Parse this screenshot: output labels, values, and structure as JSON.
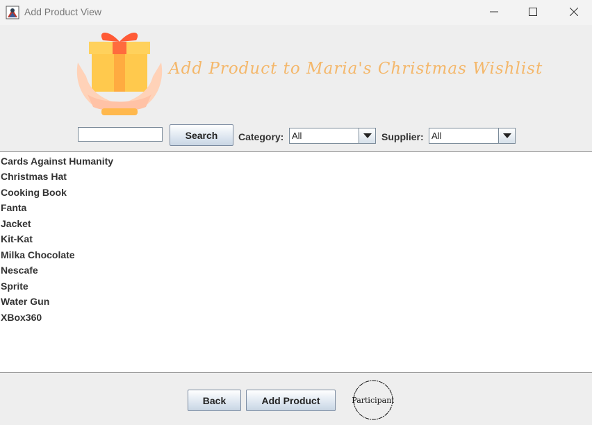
{
  "window": {
    "title": "Add Product View",
    "controls": [
      "minimize-icon",
      "maximize-icon",
      "close-icon"
    ]
  },
  "header": {
    "heading": "Add Product to Maria's Christmas Wishlist",
    "heading_color": "#f4b76a",
    "logo": "gift-in-hands-icon"
  },
  "toolbar": {
    "search_value": "",
    "search_label": "Search",
    "category_label": "Category:",
    "category_value": "All",
    "supplier_label": "Supplier:",
    "supplier_value": "All"
  },
  "products": {
    "items": [
      "Cards Against Humanity",
      "Christmas Hat",
      "Cooking Book",
      "Fanta",
      "Jacket",
      "Kit-Kat",
      "Milka Chocolate",
      "Nescafe",
      "Sprite",
      "Water Gun",
      "XBox360"
    ]
  },
  "footer": {
    "back_label": "Back",
    "add_label": "Add Product",
    "stamp_text": "Participant"
  }
}
